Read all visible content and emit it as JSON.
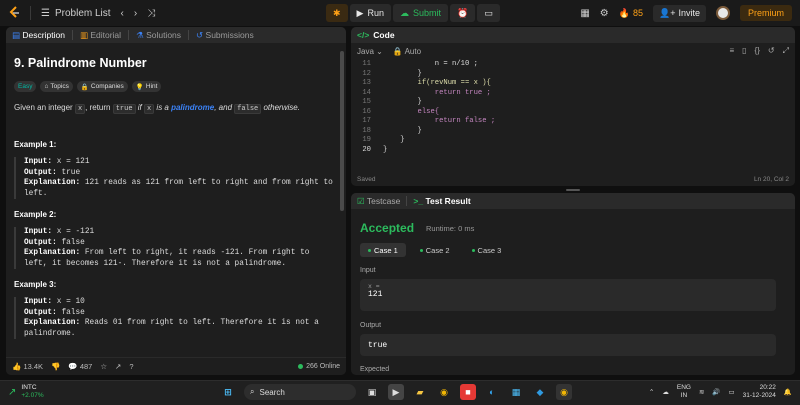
{
  "topbar": {
    "problem_list": "Problem List",
    "run": "Run",
    "submit": "Submit",
    "streak": "85",
    "invite": "Invite",
    "premium": "Premium"
  },
  "left": {
    "tabs": [
      "Description",
      "Editorial",
      "Solutions",
      "Submissions"
    ],
    "title": "9. Palindrome Number",
    "chips": [
      "Easy",
      "Topics",
      "Companies",
      "Hint"
    ],
    "desc": {
      "a": "Given an integer ",
      "x": "x",
      "b": ", return ",
      "true": "true",
      "c": " if ",
      "x2": "x",
      "d": " is a ",
      "pal": "palindrome",
      "e": ", and ",
      "false": "false",
      "f": " otherwise."
    },
    "examples": [
      {
        "title": "Example 1:",
        "input": "x = 121",
        "output": "true",
        "explanation": "121 reads as 121 from left to right and from right to left."
      },
      {
        "title": "Example 2:",
        "input": "x = -121",
        "output": "false",
        "explanation": "From left to right, it reads -121. From right to left, it becomes 121-. Therefore it is not a palindrome."
      },
      {
        "title": "Example 3:",
        "input": "x = 10",
        "output": "false",
        "explanation": "Reads 01 from right to left. Therefore it is not a palindrome."
      }
    ],
    "labels": {
      "input": "Input:",
      "output": "Output:",
      "explanation": "Explanation:"
    },
    "likes": "13.4K",
    "comments": "487",
    "online": "266 Online"
  },
  "code": {
    "title": "Code",
    "language": "Java",
    "auto": "Auto",
    "lines": [
      {
        "n": "11",
        "t": "            n = n/10 ;"
      },
      {
        "n": "12",
        "t": "        }"
      },
      {
        "n": "13",
        "t": "        if(revNum == x ){"
      },
      {
        "n": "14",
        "t": "            return true ;"
      },
      {
        "n": "15",
        "t": "        }"
      },
      {
        "n": "16",
        "t": "        else{"
      },
      {
        "n": "17",
        "t": "            return false ;"
      },
      {
        "n": "18",
        "t": "        }"
      },
      {
        "n": "19",
        "t": "    }"
      },
      {
        "n": "20",
        "t": "}"
      }
    ],
    "saved": "Saved",
    "cursor": "Ln 20, Col 2"
  },
  "test": {
    "tabs": [
      "Testcase",
      "Test Result"
    ],
    "accepted": "Accepted",
    "runtime": "Runtime: 0 ms",
    "cases": [
      "Case 1",
      "Case 2",
      "Case 3"
    ],
    "input_label": "Input",
    "var": "x =",
    "input_value": "121",
    "output_label": "Output",
    "output_value": "true",
    "expected_label": "Expected"
  },
  "taskbar": {
    "ticker": "INTC",
    "change": "+2.07%",
    "search": "Search",
    "lang1": "ENG",
    "lang2": "IN",
    "time": "20:22",
    "date": "31-12-2024"
  },
  "colors": {
    "accent": "#ffa116",
    "green": "#2cbb5d",
    "link": "#3b82f6",
    "easy": "#00b8a3"
  }
}
